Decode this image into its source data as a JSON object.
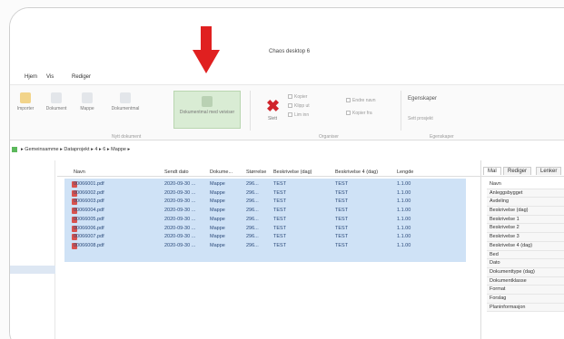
{
  "window": {
    "title": "Chaos desktop 6"
  },
  "menu": [
    "Hjem",
    "Vis",
    "Rediger"
  ],
  "ribbon": {
    "buttons": [
      {
        "label": "Importer"
      },
      {
        "label": "Dokument"
      },
      {
        "label": "Mappe"
      },
      {
        "label": "Dokumentmal"
      },
      {
        "label": "Dokumentmal med veiviser"
      },
      {
        "label": "Slett"
      }
    ],
    "small_options": [
      "Kopier",
      "Klipp ut",
      "Lim inn",
      "Endre navn",
      "Kopier fra",
      "Kopier til"
    ],
    "right_option": "Egenskaper",
    "right_option2": "Sett prosjekt",
    "groups": [
      "Nytt dokument",
      "Organiser",
      "Egenskaper"
    ]
  },
  "breadcrumb": [
    "Gemeinsamme",
    "Dataprojekt",
    "4",
    "6",
    "Mappe"
  ],
  "grid": {
    "columns": [
      "Navn",
      "Sendt dato",
      "Dokume...",
      "Størrelse",
      "Beskrivelse (dag)",
      "Beskrivelse 4 (dag)",
      "Lengde"
    ],
    "rows": [
      [
        "00066001.pdf",
        "2020-09-30 ...",
        "Mappe",
        "296...",
        "TEST",
        "TEST",
        "1.1.00"
      ],
      [
        "00066002.pdf",
        "2020-09-30 ...",
        "Mappe",
        "296...",
        "TEST",
        "TEST",
        "1.1.00"
      ],
      [
        "00066003.pdf",
        "2020-09-30 ...",
        "Mappe",
        "296...",
        "TEST",
        "TEST",
        "1.1.00"
      ],
      [
        "00066004.pdf",
        "2020-09-30 ...",
        "Mappe",
        "296...",
        "TEST",
        "TEST",
        "1.1.00"
      ],
      [
        "00066005.pdf",
        "2020-09-30 ...",
        "Mappe",
        "296...",
        "TEST",
        "TEST",
        "1.1.00"
      ],
      [
        "00066006.pdf",
        "2020-09-30 ...",
        "Mappe",
        "296...",
        "TEST",
        "TEST",
        "1.1.00"
      ],
      [
        "00066007.pdf",
        "2020-09-30 ...",
        "Mappe",
        "296...",
        "TEST",
        "TEST",
        "1.1.00"
      ],
      [
        "00066008.pdf",
        "2020-09-30 ...",
        "Mappe",
        "296...",
        "TEST",
        "TEST",
        "1.1.00"
      ]
    ]
  },
  "right_panel": {
    "tabs": [
      "Mal",
      "Rediger",
      "Lenker"
    ],
    "props": [
      "Navn",
      "Anleggsbygget",
      "Avdeling",
      "Beskrivelse (dag)",
      "Beskrivelse 1",
      "Beskrivelse 2",
      "Beskrivelse 3",
      "Beskrivelse 4 (dag)",
      "Bed",
      "Dato",
      "Dokumenttype (dag)",
      "Dokumentklasse",
      "Format",
      "Forslag",
      "Planinformasjon"
    ]
  },
  "colors": {
    "arrow": "#e02020",
    "selection": "#cfe2f6",
    "highlight": "#d9ecd4",
    "delete": "#d0242b"
  }
}
